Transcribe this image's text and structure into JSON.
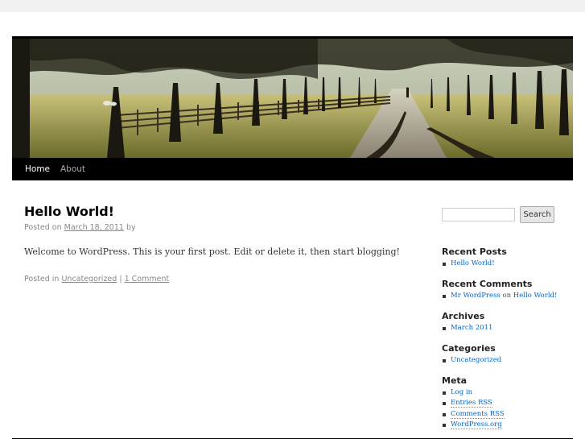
{
  "nav": {
    "items": [
      {
        "label": "Home",
        "current": true
      },
      {
        "label": "About",
        "current": false
      }
    ]
  },
  "post": {
    "title": "Hello World!",
    "meta_prefix": "Posted on",
    "date": "March 18, 2011",
    "meta_by": "by",
    "content": "Welcome to WordPress. This is your first post. Edit or delete it, then start blogging!",
    "posted_in_prefix": "Posted in",
    "category": "Uncategorized",
    "separator": "|",
    "comments": "1 Comment"
  },
  "sidebar": {
    "search": {
      "button": "Search",
      "value": ""
    },
    "recent_posts": {
      "title": "Recent Posts",
      "items": [
        "Hello World!"
      ]
    },
    "recent_comments": {
      "title": "Recent Comments",
      "items": [
        {
          "author": "Mr WordPress",
          "on": "on",
          "post": "Hello World!"
        }
      ]
    },
    "archives": {
      "title": "Archives",
      "items": [
        "March 2011"
      ]
    },
    "categories": {
      "title": "Categories",
      "items": [
        "Uncategorized"
      ]
    },
    "meta": {
      "title": "Meta",
      "items": [
        "Log in",
        "Entries RSS",
        "Comments RSS",
        "WordPress.org"
      ]
    }
  },
  "colors": {
    "page_bg": "#f1f1f1",
    "nav_bg": "#000000",
    "link": "#0066cc",
    "meta_text": "#888888"
  }
}
